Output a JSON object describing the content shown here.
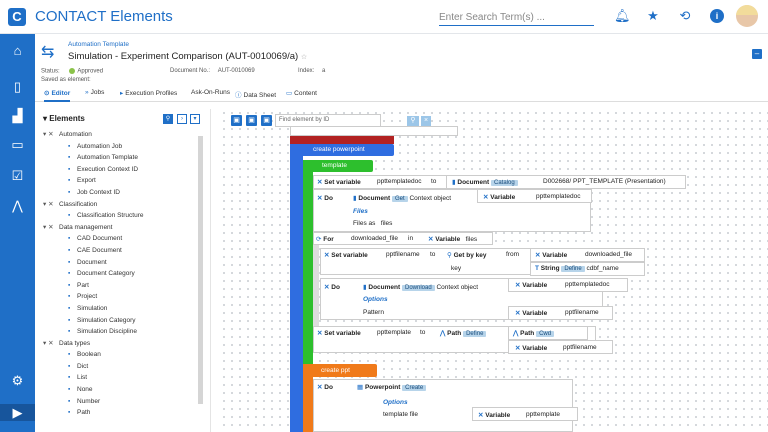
{
  "app": {
    "title": "CONTACT Elements",
    "logo_letter": "C",
    "search_placeholder": "Enter Search Term(s) ...",
    "brand_color": "#1f6fc7"
  },
  "header": {
    "breadcrumb": "Automation Template",
    "title": "Simulation - Experiment Comparison (AUT-0010069/a)",
    "star": "☆",
    "status_label": "Status:",
    "status_value": "Approved",
    "docno_label": "Document No.:",
    "docno_value": "AUT-0010069",
    "index_label": "Index:",
    "index_value": "a",
    "saved_label": "Saved as element:"
  },
  "tabs": [
    {
      "label": "Editor"
    },
    {
      "label": "Jobs"
    },
    {
      "label": "Execution Profiles"
    },
    {
      "label": "Ask-On-Runs"
    },
    {
      "label": "Data Sheet"
    },
    {
      "label": "Content"
    }
  ],
  "elements_panel": {
    "title": "Elements",
    "tree": [
      {
        "label": "Automation",
        "level": 0
      },
      {
        "label": "Automation Job",
        "level": 1
      },
      {
        "label": "Automation Template",
        "level": 1
      },
      {
        "label": "Execution Context ID",
        "level": 1
      },
      {
        "label": "Export",
        "level": 1
      },
      {
        "label": "Job Context ID",
        "level": 1
      },
      {
        "label": "Classification",
        "level": 0
      },
      {
        "label": "Classification Structure",
        "level": 1
      },
      {
        "label": "Data management",
        "level": 0
      },
      {
        "label": "CAD Document",
        "level": 1
      },
      {
        "label": "CAE Document",
        "level": 1
      },
      {
        "label": "Document",
        "level": 1
      },
      {
        "label": "Document Category",
        "level": 1
      },
      {
        "label": "Part",
        "level": 1
      },
      {
        "label": "Project",
        "level": 1
      },
      {
        "label": "Simulation",
        "level": 1
      },
      {
        "label": "Simulation Category",
        "level": 1
      },
      {
        "label": "Simulation Discipline",
        "level": 1
      },
      {
        "label": "Data types",
        "level": 0
      },
      {
        "label": "Boolean",
        "level": 1
      },
      {
        "label": "Dict",
        "level": 1
      },
      {
        "label": "List",
        "level": 1
      },
      {
        "label": "None",
        "level": 1
      },
      {
        "label": "Number",
        "level": 1
      },
      {
        "label": "Path",
        "level": 1
      }
    ]
  },
  "canvas": {
    "find_placeholder": "Find element by ID",
    "blocks": {
      "create_powerpoint": "create powerpoint",
      "template": "template",
      "set_variable": "Set variable",
      "ppttemplatedoc": "ppttemplatedoc",
      "to": "to",
      "document": "Document",
      "catalog": "Catalog",
      "catalog_value": "D002668/ PPT_TEMPLATE (Presentation)",
      "do": "Do",
      "get": "Get",
      "context_object": "Context object",
      "variable": "Variable",
      "files": "Files",
      "files_as": "Files as",
      "files_val": "files",
      "for": "For",
      "downloaded_file": "downloaded_file",
      "in": "in",
      "pptfilename": "pptfilename",
      "get_by_key": "Get by key",
      "from": "from",
      "key": "key",
      "string": "String",
      "define": "Define",
      "cdbf_name": "cdbf_name",
      "download": "Download",
      "options": "Options",
      "pattern": "Pattern",
      "ppttemplate": "ppttemplate",
      "path": "Path",
      "cwd": "Cwd",
      "create_ppt": "create ppt",
      "powerpoint": "Powerpoint",
      "create": "Create",
      "template_file": "template file"
    }
  },
  "colors": {
    "blue": "#2f6de0",
    "green": "#2dbf2d",
    "orange": "#f07a1a",
    "red": "#b22222"
  }
}
